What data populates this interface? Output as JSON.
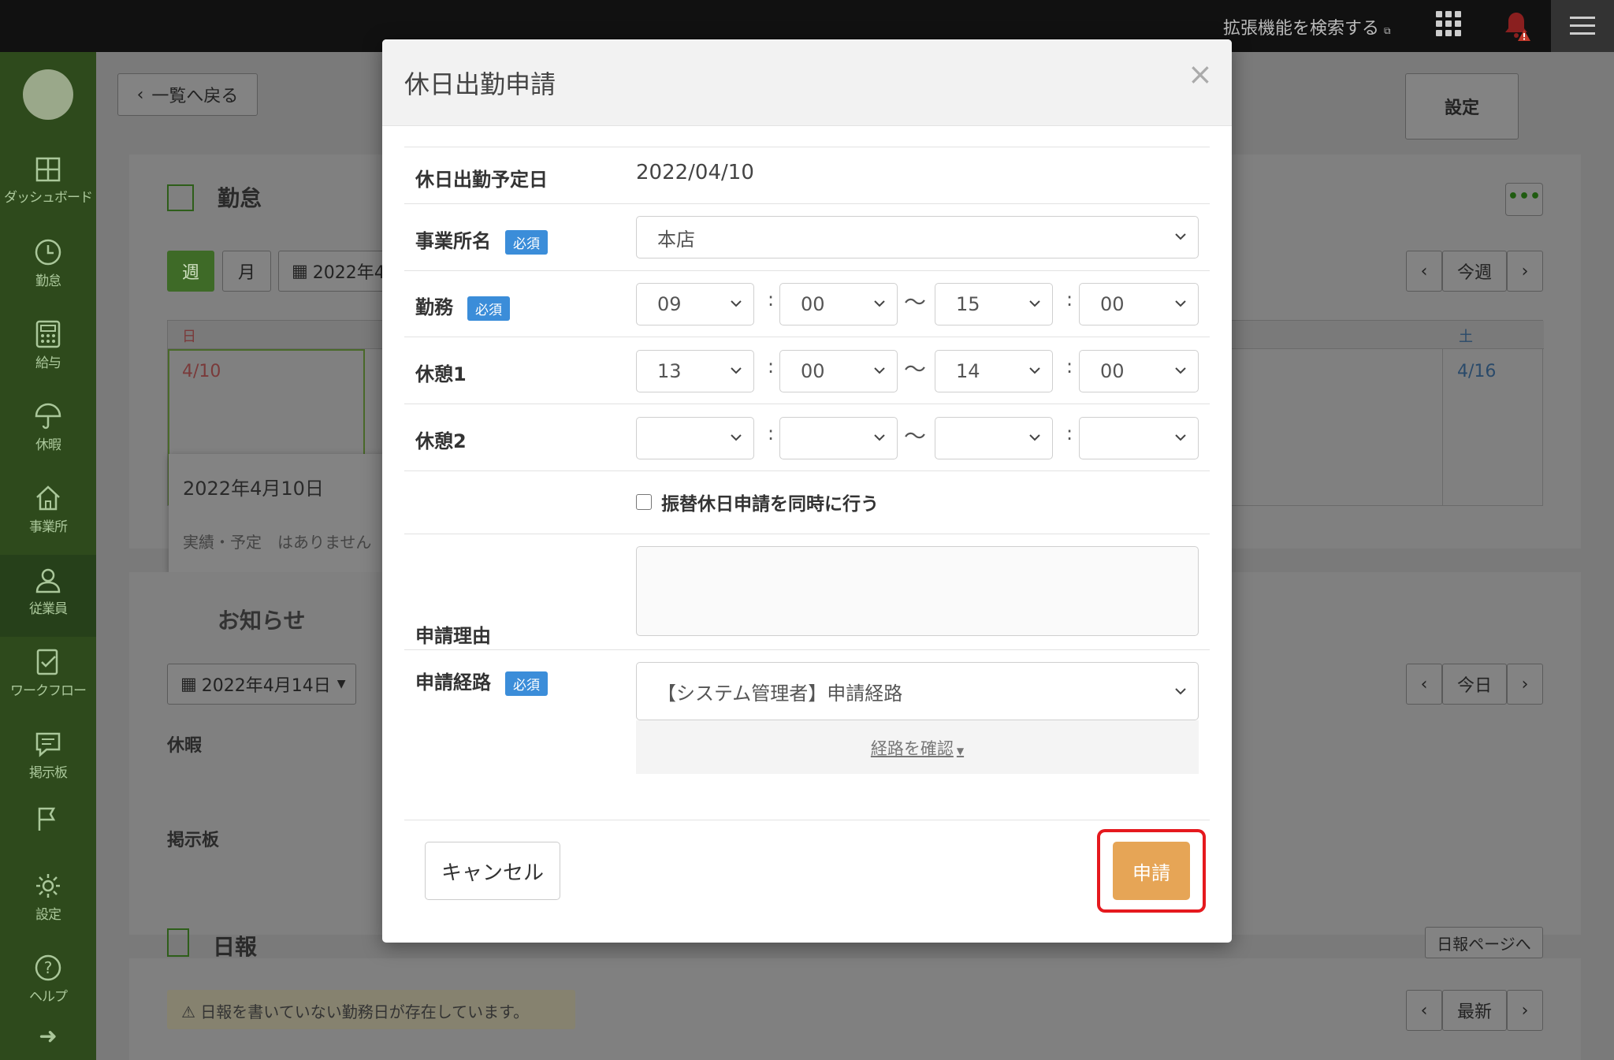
{
  "topbar": {
    "extension_search": "拡張機能を検索する",
    "extension_icon": "external-link-icon",
    "apps_icon": "apps-grid-icon",
    "bell_icon": "bell-alert-icon",
    "menu_icon": "hamburger-menu-icon"
  },
  "sidebar": {
    "items": [
      {
        "label": "ダッシュボード",
        "icon": "dashboard-icon"
      },
      {
        "label": "勤怠",
        "icon": "clock-icon"
      },
      {
        "label": "給与",
        "icon": "calculator-icon"
      },
      {
        "label": "休暇",
        "icon": "umbrella-icon"
      },
      {
        "label": "事業所",
        "icon": "home-icon"
      },
      {
        "label": "従業員",
        "icon": "person-icon"
      },
      {
        "label": "ワークフロー",
        "icon": "checklist-icon"
      },
      {
        "label": "掲示板",
        "icon": "message-icon"
      },
      {
        "label": "",
        "icon": "flag-icon"
      },
      {
        "label": "設定",
        "icon": "gear-icon"
      },
      {
        "label": "ヘルプ",
        "icon": "help-icon"
      },
      {
        "label": "",
        "icon": "arrow-right-icon"
      }
    ]
  },
  "background": {
    "back_button": "一覧へ戻る",
    "settings_button": "設定",
    "attendance_title": "勤怠",
    "week_button": "週",
    "month_button": "月",
    "date_picker": "2022年4",
    "prev": "‹",
    "this_week": "今週",
    "next": "›",
    "day_header_sun": "日",
    "day_header_sat": "土",
    "cell_sun": "4/10",
    "cell_sat": "4/16",
    "popup_date": "2022年4月10日",
    "popup_text": "実績・予定　はありません",
    "notice_title": "お知らせ",
    "notice_date": "2022年4月14日",
    "today": "今日",
    "leave_label": "休暇",
    "board_label": "掲示板",
    "daily_title": "日報",
    "daily_page_button": "日報ページへ",
    "daily_warning": "日報を書いていない勤務日が存在しています。",
    "latest": "最新"
  },
  "modal": {
    "title": "休日出勤申請",
    "close": "×",
    "required_badge": "必須",
    "fields": {
      "date_label": "休日出勤予定日",
      "date_value": "2022/04/10",
      "office_label": "事業所名",
      "office_value": "本店",
      "work_label": "勤務",
      "work_start_h": "09",
      "work_start_m": "00",
      "work_end_h": "15",
      "work_end_m": "00",
      "break1_label": "休憩1",
      "break1_start_h": "13",
      "break1_start_m": "00",
      "break1_end_h": "14",
      "break1_end_m": "00",
      "break2_label": "休憩2",
      "colon": ":",
      "tilde": "〜",
      "substitute_checkbox_label": "振替休日申請を同時に行う",
      "substitute_checked": false,
      "reason_label": "申請理由",
      "reason_value": "",
      "route_label": "申請経路",
      "route_value": "【システム管理者】申請経路",
      "route_confirm": "経路を確認"
    },
    "cancel_button": "キャンセル",
    "apply_button": "申請"
  }
}
